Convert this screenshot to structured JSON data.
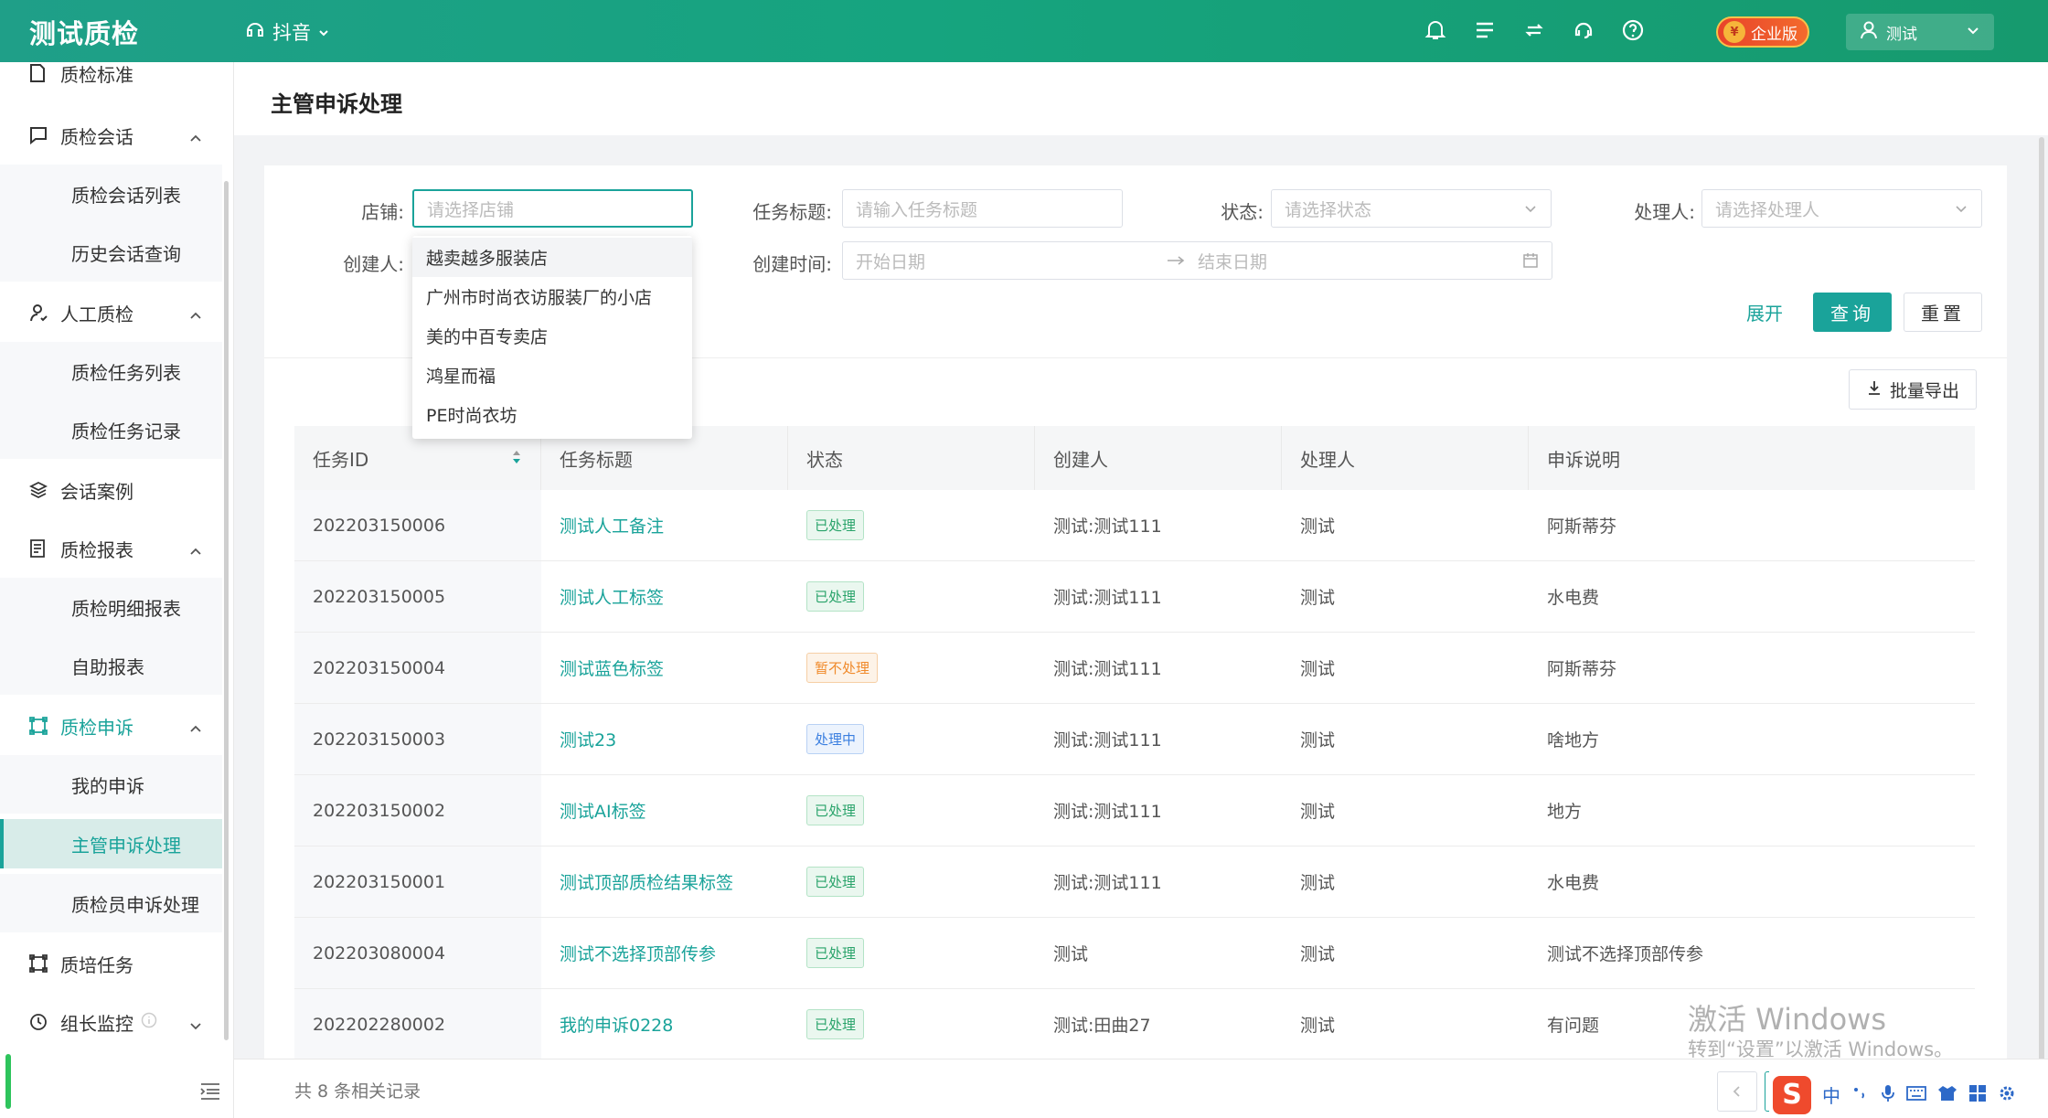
{
  "app": {
    "logo": "测试质检",
    "platform": "抖音"
  },
  "header": {
    "edition_badge": "企业版",
    "user": "测试"
  },
  "sidebar": {
    "items": [
      {
        "label": "质检标准",
        "type": "top",
        "icon": "file-icon"
      },
      {
        "label": "质检会话",
        "type": "top",
        "icon": "chat-icon"
      },
      {
        "label": "质检会话列表",
        "type": "sub"
      },
      {
        "label": "历史会话查询",
        "type": "sub"
      },
      {
        "label": "人工质检",
        "type": "top",
        "icon": "person-icon"
      },
      {
        "label": "质检任务列表",
        "type": "sub"
      },
      {
        "label": "质检任务记录",
        "type": "sub"
      },
      {
        "label": "会话案例",
        "type": "top",
        "icon": "layers-icon"
      },
      {
        "label": "质检报表",
        "type": "top",
        "icon": "report-icon"
      },
      {
        "label": "质检明细报表",
        "type": "sub"
      },
      {
        "label": "自助报表",
        "type": "sub"
      },
      {
        "label": "质检申诉",
        "type": "top",
        "icon": "appeal-icon"
      },
      {
        "label": "我的申诉",
        "type": "sub"
      },
      {
        "label": "主管申诉处理",
        "type": "sub"
      },
      {
        "label": "质检员申诉处理",
        "type": "sub"
      },
      {
        "label": "质培任务",
        "type": "top",
        "icon": "training-icon"
      },
      {
        "label": "组长监控",
        "type": "top",
        "icon": "clock-icon"
      }
    ]
  },
  "page": {
    "title": "主管申诉处理"
  },
  "filters": {
    "shop_label": "店铺:",
    "shop_placeholder": "请选择店铺",
    "task_title_label": "任务标题:",
    "task_title_placeholder": "请输入任务标题",
    "status_label": "状态:",
    "status_placeholder": "请选择状态",
    "handler_label": "处理人:",
    "handler_placeholder": "请选择处理人",
    "creator_label": "创建人:",
    "created_time_label": "创建时间:",
    "start_date_placeholder": "开始日期",
    "end_date_placeholder": "结束日期",
    "expand": "展开",
    "query": "查询",
    "reset": "重置"
  },
  "shop_dropdown": [
    "越卖越多服装店",
    "广州市时尚衣访服装厂的小店",
    "美的中百专卖店",
    "鸿星而福",
    "PE时尚衣坊"
  ],
  "table": {
    "export_label": "批量导出",
    "columns": [
      "任务ID",
      "任务标题",
      "状态",
      "创建人",
      "处理人",
      "申诉说明"
    ],
    "rows": [
      {
        "id": "202203150006",
        "title": "测试人工备注",
        "status": "已处理",
        "status_type": "done",
        "creator": "测试:测试111",
        "handler": "测试",
        "note": "阿斯蒂芬"
      },
      {
        "id": "202203150005",
        "title": "测试人工标签",
        "status": "已处理",
        "status_type": "done",
        "creator": "测试:测试111",
        "handler": "测试",
        "note": "水电费"
      },
      {
        "id": "202203150004",
        "title": "测试蓝色标签",
        "status": "暂不处理",
        "status_type": "pause",
        "creator": "测试:测试111",
        "handler": "测试",
        "note": "阿斯蒂芬"
      },
      {
        "id": "202203150003",
        "title": "测试23",
        "status": "处理中",
        "status_type": "proc",
        "creator": "测试:测试111",
        "handler": "测试",
        "note": "啥地方"
      },
      {
        "id": "202203150002",
        "title": "测试AI标签",
        "status": "已处理",
        "status_type": "done",
        "creator": "测试:测试111",
        "handler": "测试",
        "note": "地方"
      },
      {
        "id": "202203150001",
        "title": "测试顶部质检结果标签",
        "status": "已处理",
        "status_type": "done",
        "creator": "测试:测试111",
        "handler": "测试",
        "note": "水电费"
      },
      {
        "id": "202203080004",
        "title": "测试不选择顶部传参",
        "status": "已处理",
        "status_type": "done",
        "creator": "测试",
        "handler": "测试",
        "note": "测试不选择顶部传参"
      },
      {
        "id": "202202280002",
        "title": "我的申诉0228",
        "status": "已处理",
        "status_type": "done",
        "creator": "测试:田曲27",
        "handler": "测试",
        "note": "有问题"
      }
    ],
    "total": "共 8 条相关记录"
  },
  "watermark": {
    "line1": "激活 Windows",
    "line2": "转到“设置”以激活 Windows。"
  },
  "ime": {
    "logo": "S",
    "mode": "中"
  },
  "colors": {
    "accent": "#1aa39a",
    "header": "#16a47f",
    "edition_badge": "#e8432a"
  }
}
